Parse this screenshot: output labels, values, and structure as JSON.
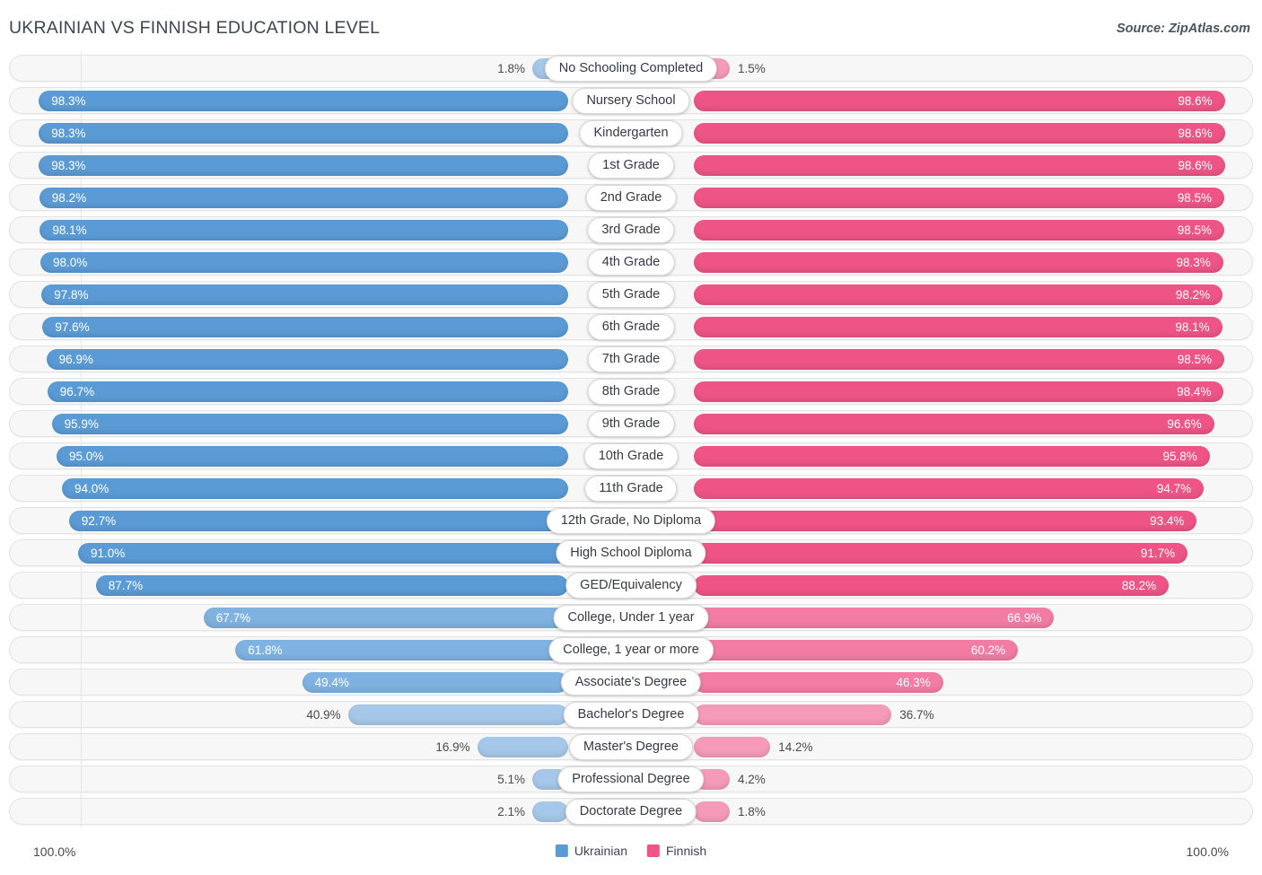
{
  "header": {
    "title": "UKRAINIAN VS FINNISH EDUCATION LEVEL",
    "source": "Source: ZipAtlas.com"
  },
  "legend": {
    "left": {
      "label": "Ukrainian",
      "color": "#5B9BD5"
    },
    "right": {
      "label": "Finnish",
      "color": "#EE5586"
    }
  },
  "axis": {
    "left_max": "100.0%",
    "right_max": "100.0%"
  },
  "colors": {
    "blue_strong": "#5B9BD5",
    "blue_mid": "#7FB2E0",
    "blue_light": "#A6C8E8",
    "pink_strong": "#EE5586",
    "pink_mid": "#F37CA4",
    "pink_light": "#F59BB9",
    "track_bg": "#F7F7F7",
    "track_border": "#E3E3E3",
    "text_dark": "#3C4650"
  },
  "chart_data": {
    "type": "bar",
    "title": "UKRAINIAN VS FINNISH EDUCATION LEVEL",
    "subtitle": "Source: ZipAtlas.com",
    "orientation": "horizontal-diverging",
    "xlabel": "",
    "ylabel": "",
    "xlim": [
      0,
      100
    ],
    "grid": false,
    "legend_position": "bottom-center",
    "categories": [
      "No Schooling Completed",
      "Nursery School",
      "Kindergarten",
      "1st Grade",
      "2nd Grade",
      "3rd Grade",
      "4th Grade",
      "5th Grade",
      "6th Grade",
      "7th Grade",
      "8th Grade",
      "9th Grade",
      "10th Grade",
      "11th Grade",
      "12th Grade, No Diploma",
      "High School Diploma",
      "GED/Equivalency",
      "College, Under 1 year",
      "College, 1 year or more",
      "Associate's Degree",
      "Bachelor's Degree",
      "Master's Degree",
      "Professional Degree",
      "Doctorate Degree"
    ],
    "series": [
      {
        "name": "Ukrainian",
        "color": "#5B9BD5",
        "values": [
          1.8,
          98.3,
          98.3,
          98.3,
          98.2,
          98.1,
          98.0,
          97.8,
          97.6,
          96.9,
          96.7,
          95.9,
          95.0,
          94.0,
          92.7,
          91.0,
          87.7,
          67.7,
          61.8,
          49.4,
          40.9,
          16.9,
          5.1,
          2.1
        ],
        "labels": [
          "1.8%",
          "98.3%",
          "98.3%",
          "98.3%",
          "98.2%",
          "98.1%",
          "98.0%",
          "97.8%",
          "97.6%",
          "96.9%",
          "96.7%",
          "95.9%",
          "95.0%",
          "94.0%",
          "92.7%",
          "91.0%",
          "87.7%",
          "67.7%",
          "61.8%",
          "49.4%",
          "40.9%",
          "16.9%",
          "5.1%",
          "2.1%"
        ]
      },
      {
        "name": "Finnish",
        "color": "#EE5586",
        "values": [
          1.5,
          98.6,
          98.6,
          98.6,
          98.5,
          98.5,
          98.3,
          98.2,
          98.1,
          98.5,
          98.4,
          96.6,
          95.8,
          94.7,
          93.4,
          91.7,
          88.2,
          66.9,
          60.2,
          46.3,
          36.7,
          14.2,
          4.2,
          1.8
        ],
        "labels": [
          "1.5%",
          "98.6%",
          "98.6%",
          "98.6%",
          "98.5%",
          "98.5%",
          "98.3%",
          "98.2%",
          "98.1%",
          "98.5%",
          "98.4%",
          "96.6%",
          "95.8%",
          "94.7%",
          "93.4%",
          "91.7%",
          "88.2%",
          "66.9%",
          "60.2%",
          "46.3%",
          "36.7%",
          "14.2%",
          "4.2%",
          "1.8%"
        ]
      }
    ]
  }
}
